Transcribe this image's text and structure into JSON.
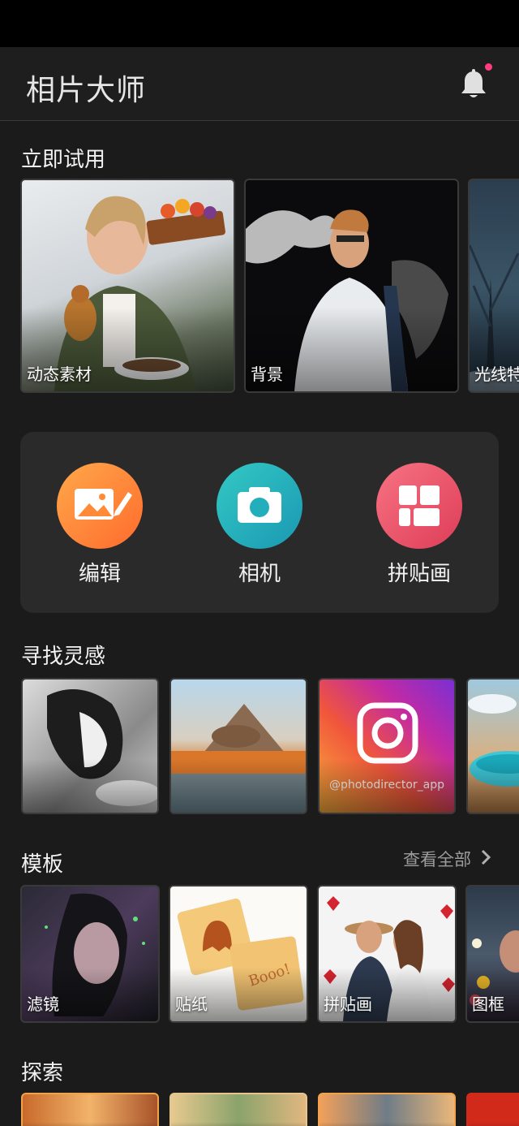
{
  "app": {
    "title": "相片大师"
  },
  "sections": {
    "try_now": "立即试用",
    "inspiration": "寻找灵感",
    "templates": "模板",
    "explore": "探索"
  },
  "try_cards": [
    {
      "label": "动态素材"
    },
    {
      "label": "背景"
    },
    {
      "label": "光线特"
    }
  ],
  "tools": [
    {
      "label": "编辑",
      "icon": "photo-edit-icon"
    },
    {
      "label": "相机",
      "icon": "camera-icon"
    },
    {
      "label": "拼贴画",
      "icon": "collage-icon"
    }
  ],
  "inspiration": {
    "instagram_handle": "@photodirector_app"
  },
  "templates": {
    "see_all": "查看全部",
    "cards": [
      {
        "label": "滤镜"
      },
      {
        "label": "贴纸"
      },
      {
        "label": "拼贴画"
      },
      {
        "label": "图框"
      }
    ]
  },
  "colors": {
    "background": "#1b1b1b",
    "notification_dot": "#ff3d7f",
    "edit_gradient": [
      "#ff9a3c",
      "#ff6a2e"
    ],
    "camera_gradient": [
      "#2ec4c7",
      "#1a9fb4"
    ],
    "collage_gradient": [
      "#f46b7b",
      "#e0405a"
    ]
  }
}
